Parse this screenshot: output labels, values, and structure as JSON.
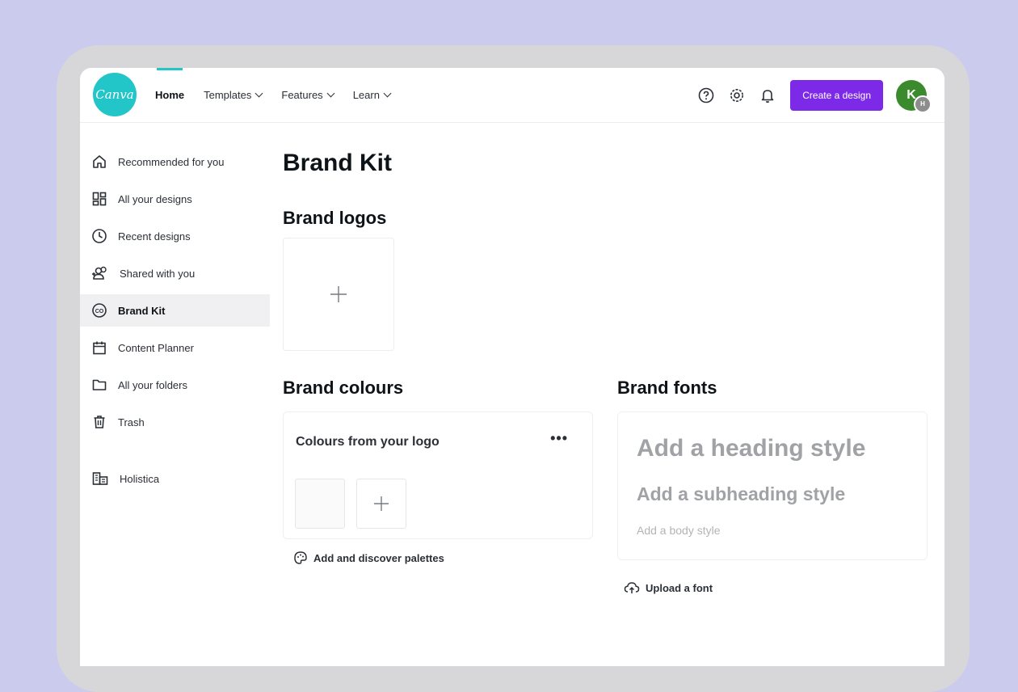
{
  "app": {
    "logo_text": "Canva"
  },
  "nav": {
    "items": [
      {
        "label": "Home",
        "active": true,
        "dropdown": false
      },
      {
        "label": "Templates",
        "dropdown": true
      },
      {
        "label": "Features",
        "dropdown": true
      },
      {
        "label": "Learn",
        "dropdown": true
      }
    ]
  },
  "header_actions": {
    "icons": [
      "help-icon",
      "settings-gear-icon",
      "notification-bell-icon"
    ],
    "create_label": "Create a design",
    "avatar_initial": "K",
    "avatar_badge": "H"
  },
  "sidebar": {
    "items": [
      {
        "label": "Recommended for you",
        "icon": "home-icon"
      },
      {
        "label": "All your designs",
        "icon": "designs-grid-icon"
      },
      {
        "label": "Recent designs",
        "icon": "clock-icon"
      },
      {
        "label": "Shared with you",
        "icon": "shared-people-icon"
      },
      {
        "label": "Brand Kit",
        "icon": "brand-kit-icon",
        "active": true
      },
      {
        "label": "Content Planner",
        "icon": "calendar-icon"
      },
      {
        "label": "All your folders",
        "icon": "folder-icon"
      },
      {
        "label": "Trash",
        "icon": "trash-icon"
      }
    ],
    "team": {
      "label": "Holistica",
      "icon": "team-building-icon"
    }
  },
  "main": {
    "title": "Brand Kit",
    "logos": {
      "title": "Brand logos"
    },
    "colours": {
      "title": "Brand colours",
      "card_title": "Colours from your logo",
      "more_label": "•••",
      "link": "Add and discover palettes"
    },
    "fonts": {
      "title": "Brand fonts",
      "heading": "Add a heading style",
      "subheading": "Add a subheading style",
      "body": "Add a body style",
      "link": "Upload a font"
    }
  },
  "colors": {
    "background": "#cbcbed",
    "accent_teal": "#22c5c8",
    "primary_purple": "#7d2ae8",
    "avatar_green": "#3c8a2e"
  }
}
